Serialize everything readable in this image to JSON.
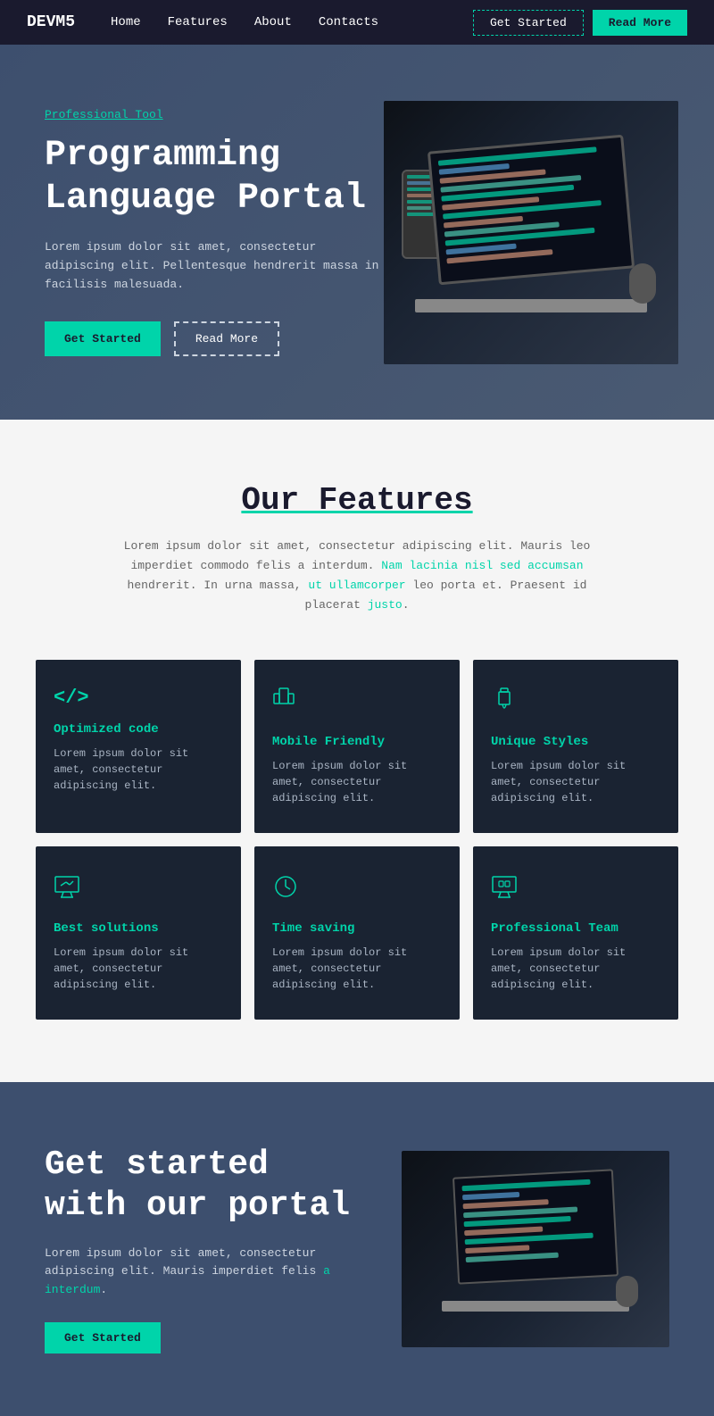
{
  "nav": {
    "logo": "DEVM5",
    "links": [
      "Home",
      "Features",
      "About",
      "Contacts"
    ],
    "btn_get_started": "Get Started",
    "btn_read_more": "Read More"
  },
  "hero": {
    "subtitle": "Professional Tool",
    "title": "Programming\nLanguage Portal",
    "description": "Lorem ipsum dolor sit amet, consectetur adipiscing elit. Pellentesque hendrerit massa in facilisis malesuada.",
    "btn_get_started": "Get Started",
    "btn_read_more": "Read More"
  },
  "features": {
    "title": "Our Features",
    "description": "Lorem ipsum dolor sit amet, consectetur adipiscing elit. Mauris leo imperdiet commodo felis a interdum. Nam lacinia nisl sed accumsan hendrerit. In urna massa, ut ullamcorper leo porta et. Praesent id placerat justo.",
    "cards": [
      {
        "icon": "code-icon",
        "title": "Optimized code",
        "description": "Lorem ipsum dolor sit amet, consectetur adipiscing elit."
      },
      {
        "icon": "mobile-icon",
        "title": "Mobile Friendly",
        "description": "Lorem ipsum dolor sit amet, consectetur adipiscing elit."
      },
      {
        "icon": "brush-icon",
        "title": "Unique Styles",
        "description": "Lorem ipsum dolor sit amet, consectetur adipiscing elit."
      },
      {
        "icon": "monitor-icon",
        "title": "Best solutions",
        "description": "Lorem ipsum dolor sit amet, consectetur adipiscing elit."
      },
      {
        "icon": "clock-icon",
        "title": "Time saving",
        "description": "Lorem ipsum dolor sit amet, consectetur adipiscing elit."
      },
      {
        "icon": "team-icon",
        "title": "Professional Team",
        "description": "Lorem ipsum dolor sit amet, consectetur adipiscing elit."
      }
    ]
  },
  "cta": {
    "title": "Get started\nwith our portal",
    "description": "Lorem ipsum dolor sit amet, consectetur adipiscing elit. Mauris imperdiet felis a interdum.",
    "btn_label": "Get Started"
  },
  "colors": {
    "teal": "#00d4aa",
    "dark_bg": "#1a1a2e",
    "hero_bg": "#4a5a72",
    "card_bg": "#1a2332"
  }
}
